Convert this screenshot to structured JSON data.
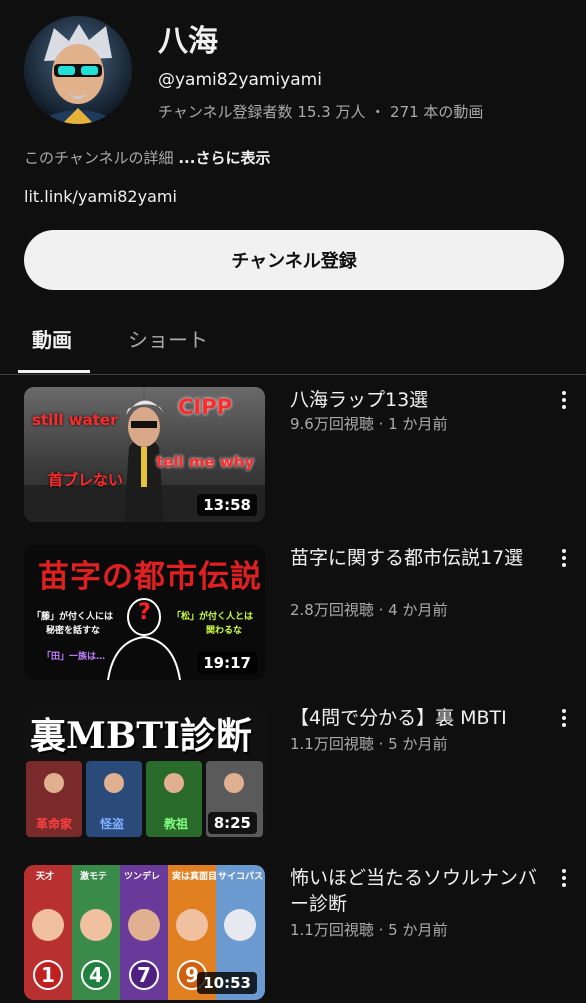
{
  "channel": {
    "name": "八海",
    "handle": "@yami82yamiyami",
    "stats": "チャンネル登録者数 15.3 万人 ・ 271 本の動画",
    "description": "このチャンネルの詳細",
    "more": "...さらに表示",
    "link": "lit.link/yami82yami",
    "subscribe_label": "チャンネル登録"
  },
  "tabs": [
    {
      "label": "動画",
      "active": true
    },
    {
      "label": "ショート",
      "active": false
    }
  ],
  "videos": [
    {
      "title": "八海ラップ13選",
      "meta": "9.6万回視聴 · 1 か月前",
      "duration": "13:58",
      "thumb_texts": [
        "still water",
        "CIPP",
        "tell me why",
        "首ブレない"
      ]
    },
    {
      "title": "苗字に関する都市伝説17選",
      "meta": "2.8万回視聴 · 4 か月前",
      "duration": "19:17",
      "thumb_texts": [
        "苗字の都市伝説",
        "「藤」が付く人には",
        "秘密を話すな",
        "「松」が付く人とは",
        "関わるな",
        "「田」一族は…",
        "?"
      ]
    },
    {
      "title": "【4問で分かる】裏 MBTI",
      "meta": "1.1万回視聴 · 5 か月前",
      "duration": "8:25",
      "thumb_texts": [
        "裏MBTI診断",
        "革命家",
        "怪盗",
        "教祖"
      ]
    },
    {
      "title": "怖いほど当たるソウルナンバー診断",
      "meta": "1.1万回視聴 · 5 か月前",
      "duration": "10:53",
      "thumb_texts": [
        "天才",
        "激モテ",
        "ツンデレ",
        "実は真面目",
        "サイコパス",
        "1",
        "4",
        "7",
        "9"
      ]
    }
  ],
  "colors": {
    "background": "#0f0f0f",
    "text": "#f1f1f1",
    "secondary": "#aaaaaa",
    "subscribe_bg": "#f1f1f1"
  }
}
